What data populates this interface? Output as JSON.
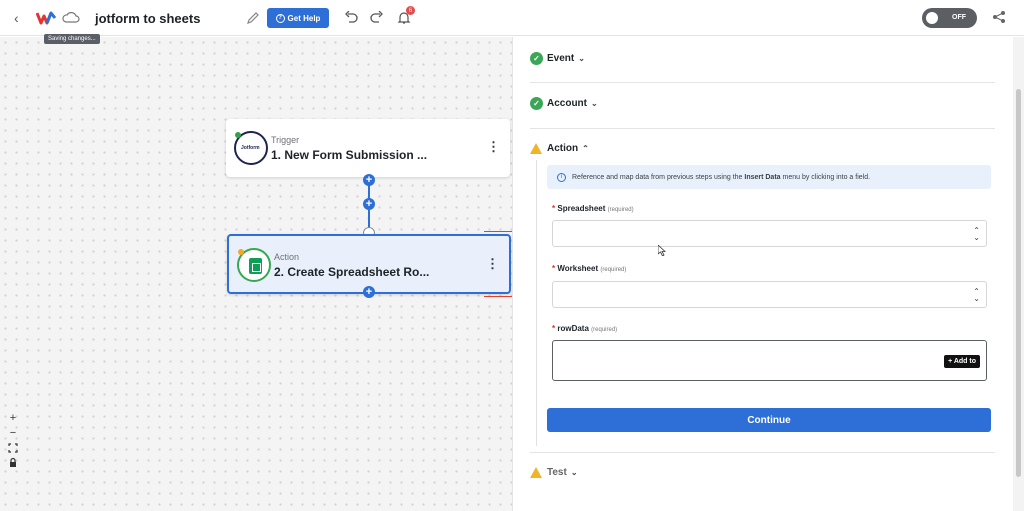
{
  "header": {
    "workflow_title": "jotform to sheets",
    "saving_tooltip": "Saving changes...",
    "get_help_label": "Get Help",
    "notification_count": "6",
    "toggle_label": "OFF"
  },
  "canvas": {
    "steps": [
      {
        "type": "Trigger",
        "name": "1. New Form Submission ...",
        "app_text": "Jotform"
      },
      {
        "type": "Action",
        "name": "2. Create Spreadsheet Ro..."
      }
    ],
    "zoom_controls": [
      "+",
      "−"
    ]
  },
  "panel": {
    "sections": {
      "event": "Event",
      "account": "Account",
      "action": "Action",
      "test": "Test"
    },
    "info_text_prefix": "Reference and map data from previous steps using the ",
    "info_text_bold": "Insert Data",
    "info_text_suffix": " menu by clicking into a field.",
    "fields": [
      {
        "label": "Spreadsheet",
        "required": "(required)"
      },
      {
        "label": "Worksheet",
        "required": "(required)"
      },
      {
        "label": "rowData",
        "required": "(required)"
      }
    ],
    "add_to_label": "+ Add to",
    "continue_label": "Continue"
  },
  "colors": {
    "primary": "#2d6fd6",
    "success": "#3aa757",
    "warning": "#f0b429",
    "annotation_arrow": "#e0402f"
  }
}
